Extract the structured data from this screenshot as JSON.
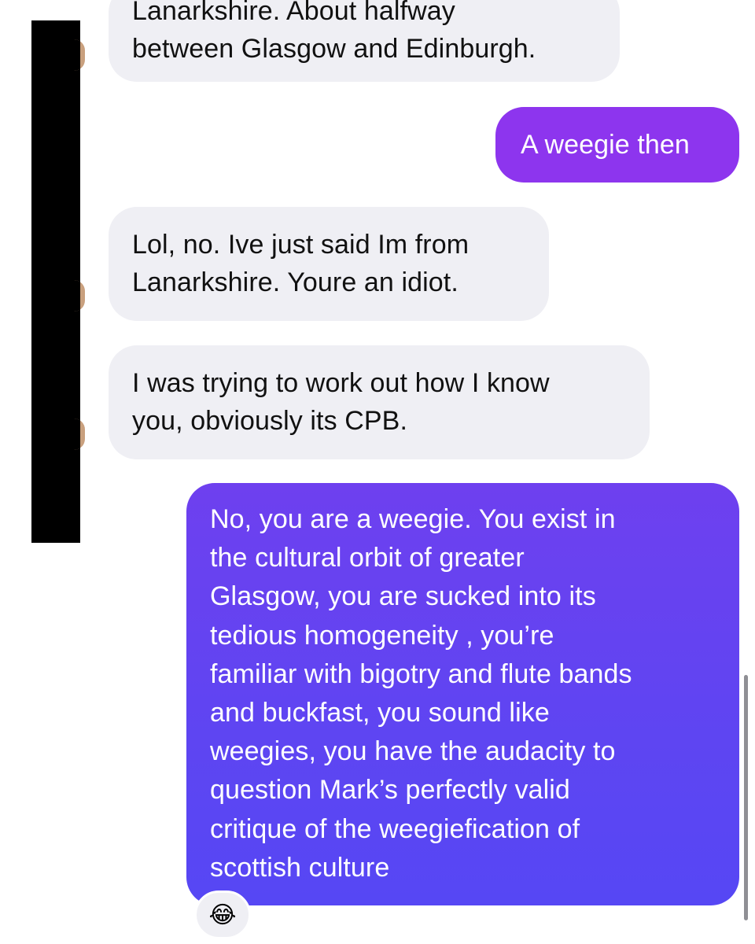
{
  "messages": [
    {
      "id": "msg1",
      "direction": "incoming",
      "lines": [
        "Lanarkshire. About halfway",
        "between Glasgow and Edinburgh."
      ]
    },
    {
      "id": "msg2",
      "direction": "outgoing",
      "lines": [
        "A weegie then"
      ]
    },
    {
      "id": "msg3",
      "direction": "incoming",
      "lines": [
        "Lol, no. Ive just said Im from",
        "Lanarkshire. Youre an idiot."
      ]
    },
    {
      "id": "msg4",
      "direction": "incoming",
      "lines": [
        "I was trying to work out how I know",
        "you, obviously its CPB."
      ]
    },
    {
      "id": "msg5",
      "direction": "outgoing",
      "lines": [
        "No, you are a weegie. You exist in",
        "the cultural orbit of greater",
        "Glasgow, you are sucked into its",
        "tedious homogeneity , you’re",
        "familiar with bigotry and flute bands",
        "and buckfast, you sound like",
        "weegies, you have the audacity to",
        "question Mark’s perfectly valid",
        "critique of the weegiefication of",
        "scottish culture"
      ]
    }
  ],
  "reaction": {
    "emoji": "😂",
    "icon": "face-with-tears-of-joy-icon"
  },
  "colors": {
    "incoming_bubble": "#efeff4",
    "outgoing_bubble_short": "#8d35ee",
    "outgoing_bubble_long": "#5e45f2",
    "redaction": "#000000"
  }
}
